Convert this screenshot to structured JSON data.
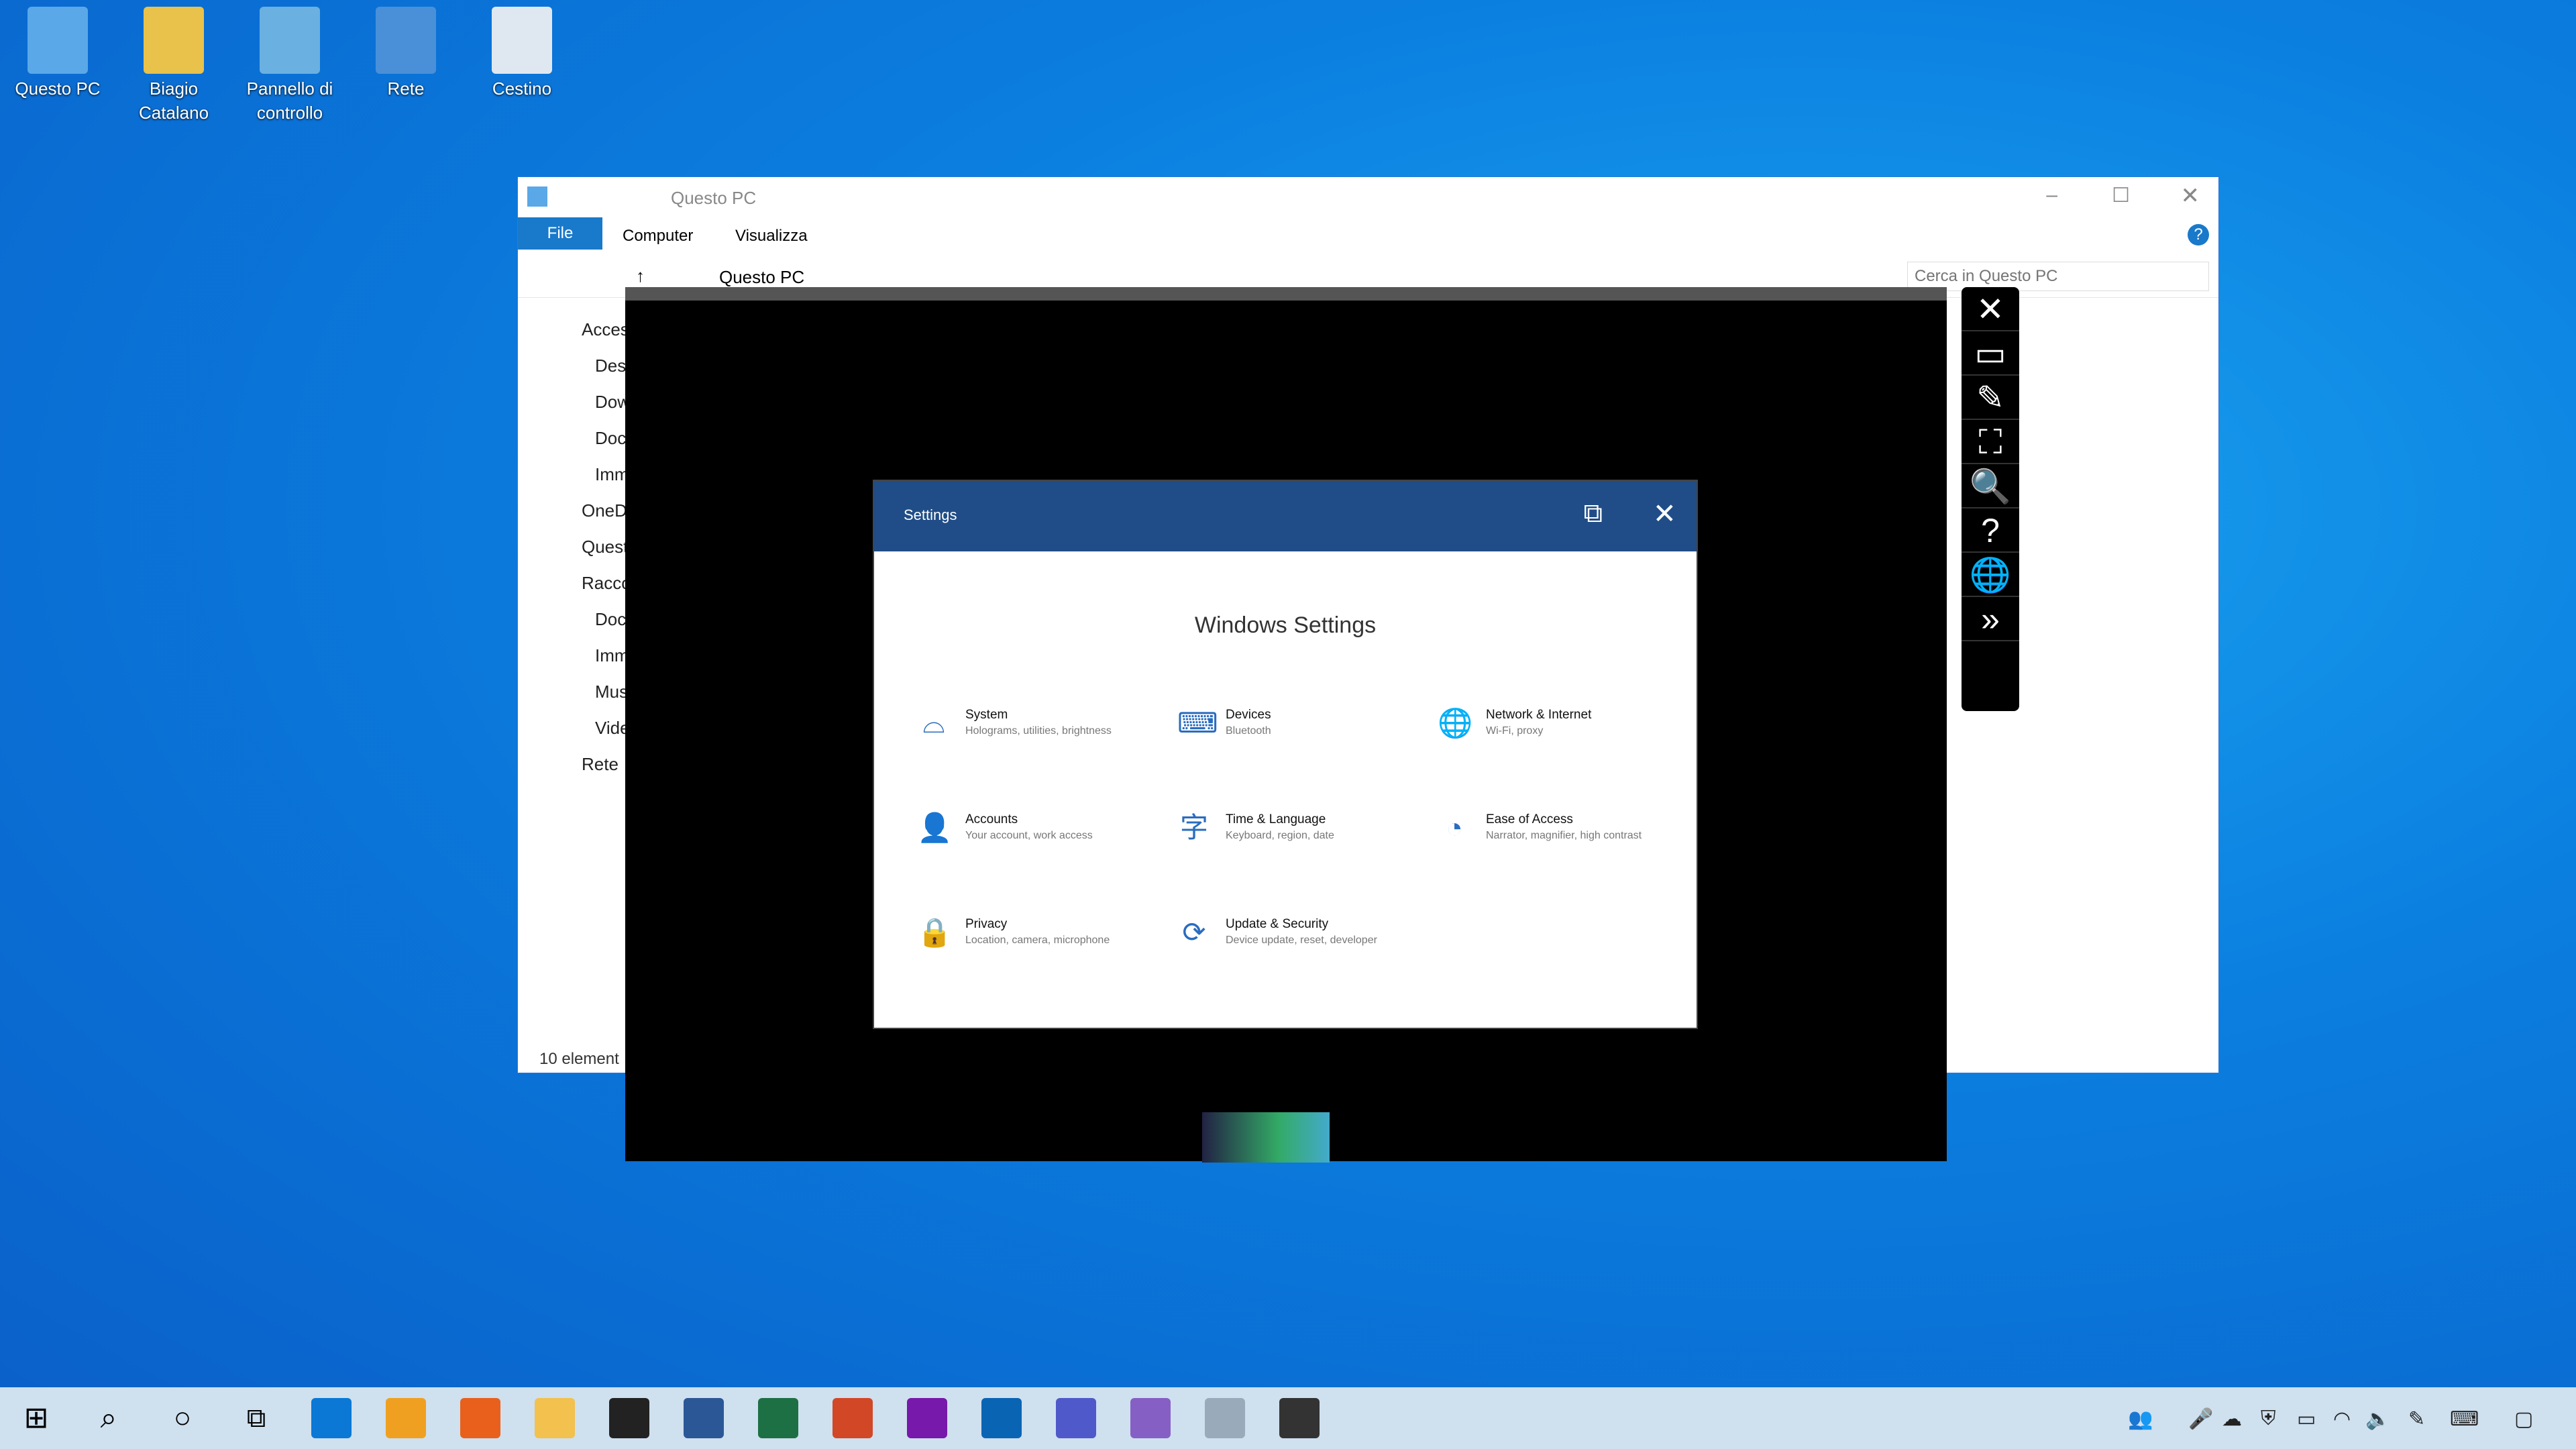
{
  "desktop": {
    "icons": [
      {
        "label": "Questo PC",
        "color": "#5aa8e8"
      },
      {
        "label": "Biagio\nCatalano",
        "color": "#e8c24a"
      },
      {
        "label": "Pannello di\ncontrollo",
        "color": "#6ab0e0"
      },
      {
        "label": "Rete",
        "color": "#4a90d8"
      },
      {
        "label": "Cestino",
        "color": "#dfe8f0"
      }
    ]
  },
  "explorer": {
    "title": "Questo PC",
    "tabs": [
      "File",
      "Computer",
      "Visualizza"
    ],
    "breadcrumb": "Questo PC",
    "search_placeholder": "Cerca in Questo PC",
    "nav": [
      "Acces",
      "Desk",
      "Dow",
      "Doc",
      "Imm",
      "OneD",
      "Quest",
      "Racco",
      "Doc",
      "Imm",
      "Mus",
      "Vide",
      "Rete"
    ],
    "status": "10 element"
  },
  "settings": {
    "window_title": "Settings",
    "heading": "Windows Settings",
    "items": [
      {
        "icon": "⌓",
        "title": "System",
        "desc": "Holograms, utilities, brightness"
      },
      {
        "icon": "⌨",
        "title": "Devices",
        "desc": "Bluetooth"
      },
      {
        "icon": "🌐",
        "title": "Network & Internet",
        "desc": "Wi-Fi, proxy"
      },
      {
        "icon": "👤",
        "title": "Accounts",
        "desc": "Your account, work access"
      },
      {
        "icon": "字",
        "title": "Time & Language",
        "desc": "Keyboard, region, date"
      },
      {
        "icon": "◔",
        "title": "Ease of Access",
        "desc": "Narrator, magnifier, high contrast"
      },
      {
        "icon": "🔒",
        "title": "Privacy",
        "desc": "Location, camera, microphone"
      },
      {
        "icon": "⟳",
        "title": "Update & Security",
        "desc": "Device update, reset, developer"
      }
    ]
  },
  "toolbar": [
    "✕",
    "▭",
    "✎",
    "⛶",
    "🔍",
    "?",
    "🌐",
    "»"
  ],
  "taskbar": {
    "apps": [
      {
        "name": "edge",
        "color": "#0a78d4"
      },
      {
        "name": "edge-can",
        "color": "#f0a020"
      },
      {
        "name": "firefox",
        "color": "#e8601c"
      },
      {
        "name": "file-explorer",
        "color": "#f2c14e"
      },
      {
        "name": "store",
        "color": "#222"
      },
      {
        "name": "word",
        "color": "#2b5797"
      },
      {
        "name": "excel",
        "color": "#1d7044"
      },
      {
        "name": "powerpoint",
        "color": "#d24726"
      },
      {
        "name": "onenote",
        "color": "#7719aa"
      },
      {
        "name": "outlook",
        "color": "#0a64b4"
      },
      {
        "name": "teams",
        "color": "#5059c9"
      },
      {
        "name": "visual-studio",
        "color": "#865fc5"
      },
      {
        "name": "mixed-reality",
        "color": "#9ab"
      },
      {
        "name": "settings",
        "color": "#333"
      }
    ]
  }
}
